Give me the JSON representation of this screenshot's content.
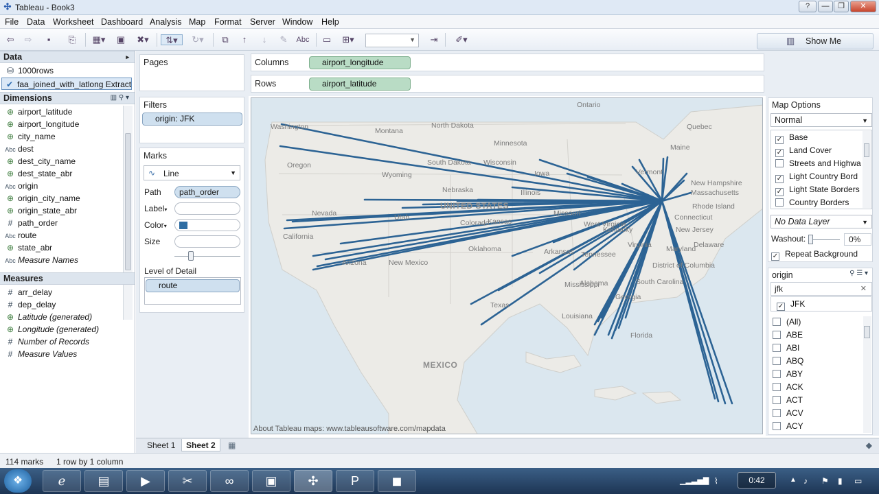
{
  "window": {
    "title": "Tableau - Book3",
    "controls": {
      "help": "?",
      "minimize": "—",
      "restore": "❐",
      "close": "✕"
    }
  },
  "menu": [
    "File",
    "Data",
    "Worksheet",
    "Dashboard",
    "Analysis",
    "Map",
    "Format",
    "Server",
    "Window",
    "Help"
  ],
  "toolbar": {
    "abc": "Abc",
    "show_me": "Show Me"
  },
  "data_pane": {
    "header": "Data",
    "sources": [
      {
        "label": "1000rows"
      },
      {
        "label": "faa_joined_with_latlong Extract"
      }
    ],
    "dimensions_header": "Dimensions",
    "dimensions": [
      {
        "type": "geo",
        "label": "airport_latitude"
      },
      {
        "type": "geo",
        "label": "airport_longitude"
      },
      {
        "type": "geo",
        "label": "city_name"
      },
      {
        "type": "abc",
        "label": "dest"
      },
      {
        "type": "geo",
        "label": "dest_city_name"
      },
      {
        "type": "geo",
        "label": "dest_state_abr"
      },
      {
        "type": "abc",
        "label": "origin"
      },
      {
        "type": "geo",
        "label": "origin_city_name"
      },
      {
        "type": "geo",
        "label": "origin_state_abr"
      },
      {
        "type": "num",
        "label": "path_order"
      },
      {
        "type": "abc",
        "label": "route"
      },
      {
        "type": "geo",
        "label": "state_abr"
      },
      {
        "type": "abc",
        "label": "Measure Names",
        "italic": true
      }
    ],
    "measures_header": "Measures",
    "measures": [
      {
        "type": "num",
        "label": "arr_delay"
      },
      {
        "type": "num",
        "label": "dep_delay"
      },
      {
        "type": "geo",
        "label": "Latitude (generated)",
        "italic": true
      },
      {
        "type": "geo",
        "label": "Longitude (generated)",
        "italic": true
      },
      {
        "type": "num",
        "label": "Number of Records",
        "italic": true
      },
      {
        "type": "num",
        "label": "Measure Values",
        "italic": true
      }
    ]
  },
  "pages_card": {
    "title": "Pages"
  },
  "filters_card": {
    "title": "Filters",
    "pill": "origin: JFK"
  },
  "marks_card": {
    "title": "Marks",
    "mark_type": "Line",
    "path_label": "Path",
    "path_value": "path_order",
    "label_label": "Label",
    "color_label": "Color",
    "size_label": "Size",
    "lod_label": "Level of Detail",
    "lod_pill": "route",
    "color_swatch": "#2f6da3"
  },
  "shelves": {
    "columns_label": "Columns",
    "columns_pill": "airport_longitude",
    "rows_label": "Rows",
    "rows_pill": "airport_latitude"
  },
  "map": {
    "attribution": "About Tableau maps: www.tableausoftware.com/mapdata",
    "route_color": "#2c6394",
    "labels": [
      "Washington",
      "Montana",
      "North Dakota",
      "Ontario",
      "Quebec",
      "Oregon",
      "Minnesota",
      "South Dakota",
      "Wisconsin",
      "Maine",
      "Wyoming",
      "Iowa",
      "Nebraska",
      "Illinois",
      "Vermont",
      "New Hampshire",
      "Massachusetts",
      "UNITED STATES",
      "Nevada",
      "Utah",
      "Colorado",
      "Kansas",
      "Rhode Island",
      "Connecticut",
      "Missouri",
      "Kentucky",
      "West Virginia",
      "New Jersey",
      "Virginia",
      "Delaware",
      "Maryland",
      "California",
      "Oklahoma",
      "Arkansas",
      "Tennessee",
      "District of Columbia",
      "Arizona",
      "New Mexico",
      "Mississippi",
      "Alabama",
      "South Carolina",
      "Texas",
      "Georgia",
      "Louisiana",
      "Florida",
      "MEXICO"
    ]
  },
  "map_options": {
    "title": "Map Options",
    "style": "Normal",
    "layers": [
      {
        "label": "Base",
        "checked": true
      },
      {
        "label": "Land Cover",
        "checked": true
      },
      {
        "label": "Streets and Highwa",
        "checked": false
      },
      {
        "label": "Light Country Bord",
        "checked": true
      },
      {
        "label": "Light State Borders",
        "checked": true
      },
      {
        "label": "Country Borders",
        "checked": false
      }
    ],
    "data_layer": "No Data Layer",
    "washout_label": "Washout:",
    "washout_value": "0%",
    "repeat_background": "Repeat Background"
  },
  "quick_filter": {
    "title": "origin",
    "search_value": "jfk",
    "match": "JFK",
    "items": [
      "(All)",
      "ABE",
      "ABI",
      "ABQ",
      "ABY",
      "ACK",
      "ACT",
      "ACV",
      "ACY"
    ]
  },
  "tabs": [
    "Sheet 1",
    "Sheet 2"
  ],
  "status": {
    "marks": "114 marks",
    "dims": "1 row by 1 column"
  },
  "tray": {
    "clock": "0:42"
  }
}
